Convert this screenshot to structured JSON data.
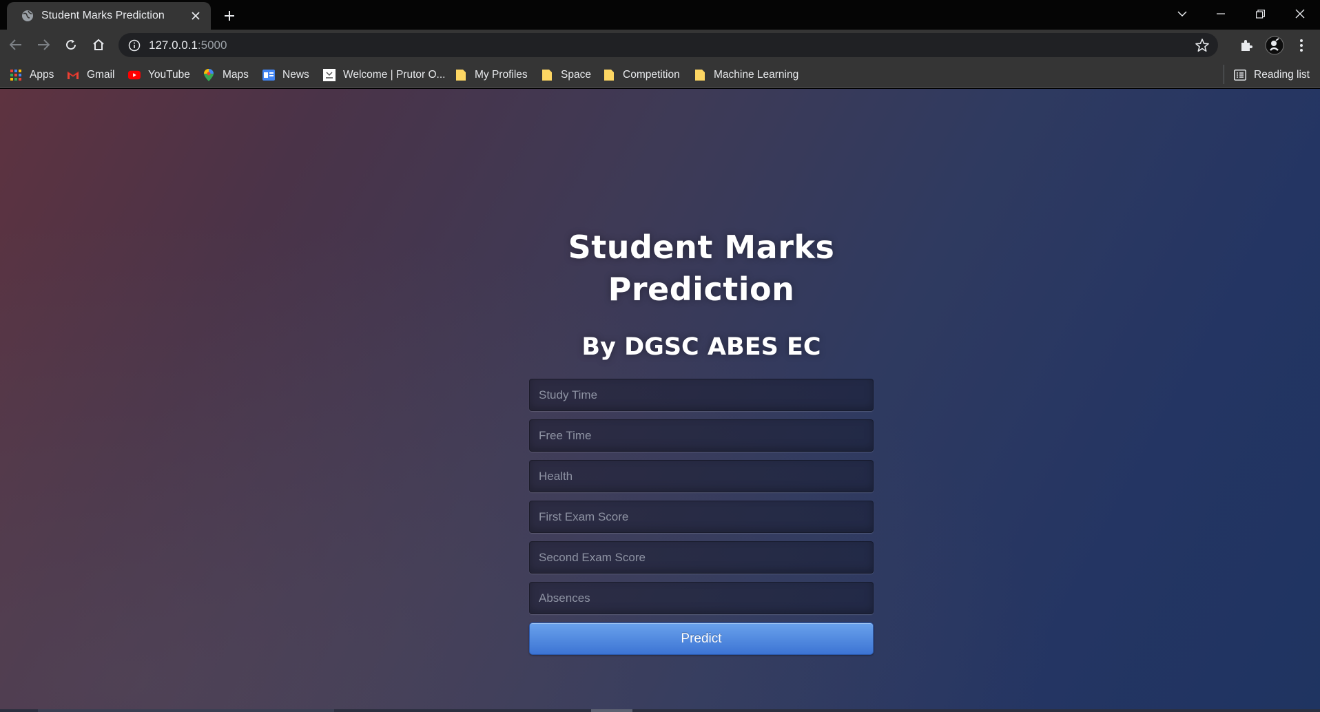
{
  "browser": {
    "tab_title": "Student Marks Prediction",
    "address_host": "127.0.0.1",
    "address_port": ":5000",
    "bookmarks": [
      {
        "label": "Apps",
        "icon": "apps-grid-icon"
      },
      {
        "label": "Gmail",
        "icon": "gmail-icon"
      },
      {
        "label": "YouTube",
        "icon": "youtube-icon"
      },
      {
        "label": "Maps",
        "icon": "maps-pin-icon"
      },
      {
        "label": "News",
        "icon": "news-icon"
      },
      {
        "label": "Welcome | Prutor O...",
        "icon": "prutor-icon"
      },
      {
        "label": "My Profiles",
        "icon": "folder-icon"
      },
      {
        "label": "Space",
        "icon": "folder-icon"
      },
      {
        "label": "Competition",
        "icon": "folder-icon"
      },
      {
        "label": "Machine Learning",
        "icon": "folder-icon"
      }
    ],
    "reading_list": "Reading list"
  },
  "page": {
    "title_line1": "Student Marks",
    "title_line2": "Prediction",
    "subtitle": "By DGSC ABES EC",
    "fields": {
      "study_time": "Study Time",
      "free_time": "Free Time",
      "health": "Health",
      "first_exam": "First Exam Score",
      "second_exam": "Second Exam Score",
      "absences": "Absences"
    },
    "predict_label": "Predict"
  },
  "colors": {
    "button": "#4f89e0",
    "background_left": "#5e3340",
    "background_right": "#1f3461"
  }
}
